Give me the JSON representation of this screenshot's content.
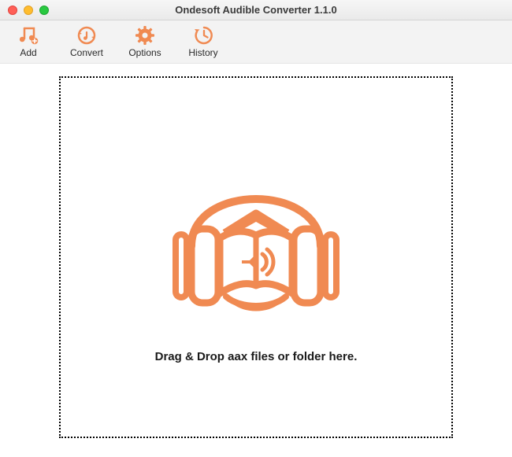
{
  "colors": {
    "accent": "#f08a52"
  },
  "window": {
    "title": "Ondesoft Audible Converter 1.1.0"
  },
  "toolbar": {
    "add": {
      "label": "Add",
      "icon": "add-music-icon"
    },
    "convert": {
      "label": "Convert",
      "icon": "convert-icon"
    },
    "options": {
      "label": "Options",
      "icon": "gear-icon"
    },
    "history": {
      "label": "History",
      "icon": "history-icon"
    }
  },
  "dropzone": {
    "illustration": "audiobook-headphones-icon",
    "instruction": "Drag & Drop aax files or folder here."
  }
}
